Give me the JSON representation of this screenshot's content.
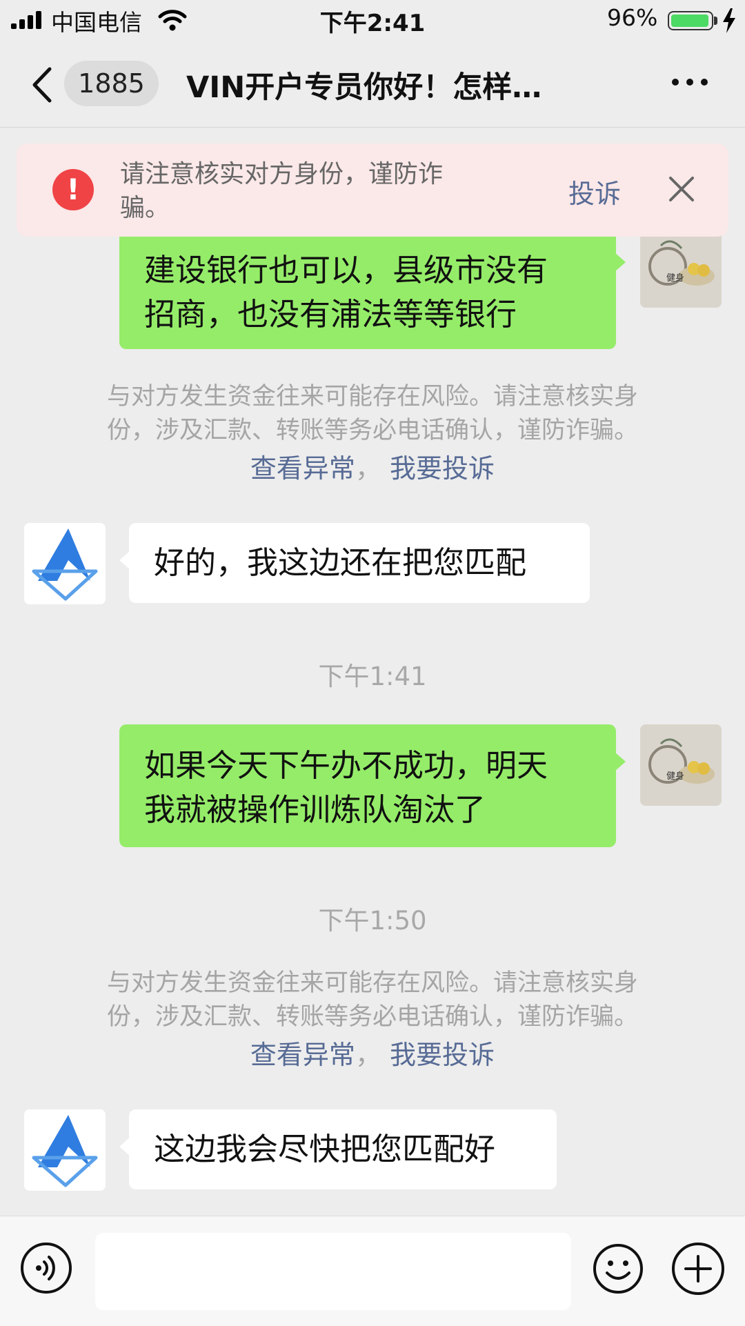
{
  "status_bar": {
    "carrier": "中国电信",
    "time": "下午2:41",
    "battery_percent": "96%",
    "battery_level": 0.96,
    "icons": [
      "signal-icon",
      "wifi-icon",
      "battery-icon",
      "charging-icon"
    ]
  },
  "nav": {
    "back_icon": "chevron-left-icon",
    "unread_count": "1885",
    "title": "VIN开户专员你好！怎样…",
    "more_icon": "more-dots-icon"
  },
  "warning_banner": {
    "text": "请注意核实对方身份，谨防诈骗。",
    "complain_label": "投诉",
    "colors": {
      "background": "#fbe8e8",
      "alert": "#f04346",
      "link": "#576b95"
    }
  },
  "messages": [
    {
      "type": "outgoing",
      "lines": [
        "建设银行也可以，县级市没有",
        "招商，也没有浦法等等银行"
      ]
    },
    {
      "type": "risk_notice",
      "lines": [
        "与对方发生资金往来可能存在风险。请注意核实身",
        "份，涉及汇款、转账等务必电话确认，谨防诈骗。"
      ],
      "link_view": "查看异常",
      "separator": "，",
      "link_complain": "我要投诉"
    },
    {
      "type": "incoming",
      "text": "好的，我这边还在把您匹配"
    },
    {
      "type": "timestamp",
      "text": "下午1:41"
    },
    {
      "type": "outgoing",
      "lines": [
        "如果今天下午办不成功，明天",
        "我就被操作训炼队淘汰了"
      ]
    },
    {
      "type": "timestamp",
      "text": "下午1:50"
    },
    {
      "type": "risk_notice",
      "lines": [
        "与对方发生资金往来可能存在风险。请注意核实身",
        "份，涉及汇款、转账等务必电话确认，谨防诈骗。"
      ],
      "link_view": "查看异常",
      "separator": "，",
      "link_complain": "我要投诉"
    },
    {
      "type": "incoming",
      "text": "这边我会尽快把您匹配好"
    }
  ],
  "avatars": {
    "self_label": "健身"
  },
  "input_bar": {
    "voice_icon": "voice-icon",
    "input_value": "",
    "emoji_icon": "emoji-icon",
    "plus_icon": "plus-icon"
  },
  "colors": {
    "chat_background": "#ededed",
    "outgoing_bubble": "#95ec69",
    "incoming_bubble": "#ffffff",
    "timestamp": "#a8a8a8"
  }
}
